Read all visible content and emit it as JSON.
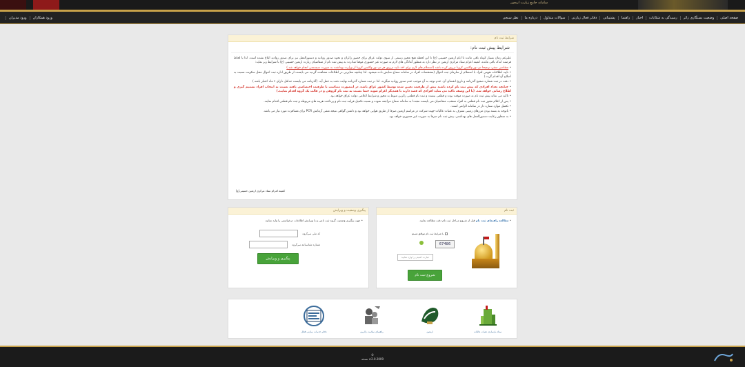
{
  "header": {
    "title": "سامانه جامع زیارت اربعین"
  },
  "nav": {
    "items": [
      "صفحه اصلی",
      "وضعیت بستگاری زائر",
      "رسیدگی به شکایات",
      "اخبار",
      "راهنما",
      "پشتیبانی",
      "دفاتر فعال زیارتی",
      "سوالات متداول",
      "درباره ما",
      "نظر سنجی"
    ],
    "left_items": [
      "ورود همکاران",
      "ورود مدیران"
    ]
  },
  "terms": {
    "head": "شرایط ثبت نام",
    "title": "شرایط پیش ثبت نام:",
    "intro": "علیرغم زمان بسیار کوتاه باقی مانده تا ایام اربعین حسینی (ع) تا این لحظه هیچ مجوز رسمی از سوی دولت عراق برای حضور زائران و نحوه صدور روادید و دستورالعمل نیز برای صدور روادید ابلاغ نشده است. لذا با لحاظ فرصت اندک باقی مانده، کمیته اعزام ستاد مرکزی اربعین در نظر دارد به منظور آمادگی های لازم به صورت غیر حضوری موقتا مبادرت به پیش ثبت نام از متقاضیان زیارت اربعین حسینی (ع) با شرایط زیر نماید:",
    "items": [
      "متقاضی سفر، ترجیحا دو دوز واکسن کرونا تزریق کرده باشد (استعلام های لازم برای اخذ تایید تزریق هر دو دوز واکسن کرونا از وزارت بهداشت به صورت سیستمی انجام خواهد شد.)",
      "تایید اطلاعات هویتی افراد با استعلام از سازمان ثبت احوال (مشخصات افراد در سامانه سماح نمایش داده میشود. لذا چنانچه مغایرتی در اطلاعات مشاهده گردید می بایست از طریق اداره ثبت احوال محل سکونت نسبت به اصلاح آن اقدام گردد.)",
      "دقت در ثبت شماره صحیح گذرنامه و تاریخ انقضای آن. عدم توجه به آن موجب عدم صدور روادید میگردد. لذا در ثبت شماره گذرنامه نهایت دقت به عمل آید. (گذرنامه می بایست حداقل دارای ۶ ماه اعتبار باشد.)",
      "چنانچه تعداد افرادی که پیش ثبت نام کرده باشند بیش از ظرفیت تعیین شده توسط کشور عراق باشد، در اینصورت متناسب با ظرفیت اختصاصی یافته نسبت به انتخاب افراد تصمیم گیری و اطلاع رسانی خواهد شد. (با این وصف تاکید می نماید افرادی که قصد دارند با همدیگر اعزام شوند حتما نسبت به ثبت نام گروهی و در قالب یک گروه اقدام نمایند.)",
      "تاکید می نماید پیش ثبت نام به صورت موقت بوده و قطعی نیست و ثبت نام قطعی زائرین منوط به مجوز و شرایط اعلامی دولت عراق خواهد بود.",
      "پس از اعلام مجوز ثبت نام قطعی به افراد منتخب، متقاضیان می بایست مجددا به سامانه سماح مراجعه نموده و نسبت تکمیل فرایند ثبت نام و پرداخت هزینه های مربوطه و ثبت نام قطعی اقدام نمایند.",
      "تکمیل موارد ستاره دار در سامانه الزامی است.",
      "باتوجه به بسته بودن مرزهای زمینی تشرف به عتبات عالیات جهت شرکت در مراسم اربعین صرفا از طریق هوایی خواهد بود و داشتن گواهی نتیجه منفی آزمایش PCR برای مسافرت مورد نیاز می باشد.",
      "به منظور رعایت دستورالعمل های بهداشتی، پیش ثبت نام صرفا به صورت غیر حضوری خواهد بود."
    ],
    "signature": "کمیته اعزام ستاد مرکزی اربعین حسینی(ع)"
  },
  "register": {
    "head": "ثبت نام",
    "note_bold": "مطالعه راهنمای ثبت نام",
    "note_rest": " قبل از شروع مراحل ثبت نام دقت مطالعه نمایید.",
    "agree": "با شرایط ثبت نام موافق هستم",
    "captcha": "67486",
    "captcha_placeholder": "عبارت امنیتی را وارد نمایید",
    "start_button": "شروع ثبت نام"
  },
  "track": {
    "head": "پیگیری وضعیت و ویرایش",
    "note": "جهت پیگیری وضعیت گروه ثبت نامی و یا ویرایش اطلاعات درخواستی را وارد نمایید.",
    "field1": "کد ملی سرگروه",
    "field2": "شماره شناسنامه سرگروه",
    "button": "پیگیری و ویرایش"
  },
  "partners": [
    {
      "label": "ستاد بازسازی عتبات عالیات",
      "icon": "atabat-logo-icon"
    },
    {
      "label": "اربعین",
      "icon": "arbaeen-logo-icon"
    },
    {
      "label": "راهنمای سلامت زائرین",
      "icon": "health-guide-icon"
    },
    {
      "label": "دفاتر خدمات زیارتی فعال",
      "icon": "hajj-office-icon"
    }
  ],
  "footer": {
    "line1": "©",
    "line2": "v:2.0.2009 نسخه"
  },
  "colors": {
    "accent_green": "#48a33a",
    "gold": "#c8a24a",
    "dark": "#1b1b1b",
    "alert_red": "#d2281f"
  }
}
